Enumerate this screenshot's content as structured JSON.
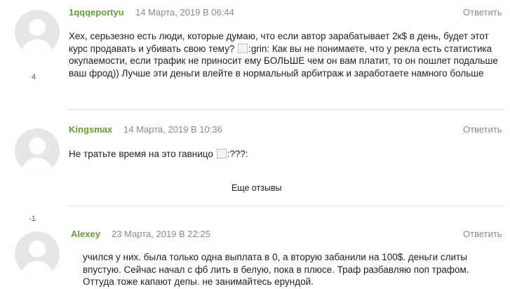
{
  "comments": [
    {
      "author": "1qqqeportyu",
      "date": "14 Марта, 2019 В 06:44",
      "reply_label": "Ответить",
      "score": "4",
      "text_parts": [
        "Хех, серьзезно есть люди, которые думаю, что если автор зарабатывает 2к$ в день, будет этот курс продавать и убивать свою тему? ",
        ":grin: Как вы не понимаете, что у рекла есть статистика окупаемости, если трафик не приносит ему БОЛЬШЕ чем он вам платит, то он пошлет подальше ваш фрод)) Лучше эти деньги влейте в нормальный арбитраж и заработаете намного больше"
      ]
    },
    {
      "author": "Kingsmax",
      "date": "14 Марта, 2019 В 10:36",
      "reply_label": "Ответить",
      "score": "-1",
      "text_parts": [
        "Не тратьте время на это гавницо ",
        ":???:"
      ]
    },
    {
      "author": "Alexey",
      "date": "23 Марта, 2019 В 22:25",
      "reply_label": "Ответить",
      "text": "учился у них. была только одна выплата в 0, а вторую забанили на 100$. деньги слиты впустую. Сейчас начал с фб лить в белую, пока в плюсе. Траф разбавляю поп трафом. Оттуда тоже капают депы. не занимайтесь ерундой."
    }
  ],
  "more_reviews_label": "Еще отзывы",
  "icons": {
    "avatar": "default-avatar-icon",
    "emoji_placeholder": "broken-image-icon"
  },
  "colors": {
    "author": "#5ea52b",
    "meta": "#8a8a8a",
    "divider": "#e3e3e3",
    "avatar_bg": "#e6e6e6"
  }
}
